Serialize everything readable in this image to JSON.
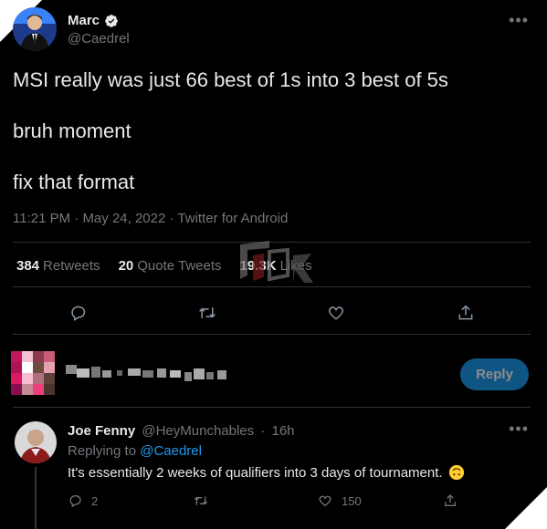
{
  "tweet": {
    "display_name": "Marc",
    "handle": "@Caedrel",
    "lines": [
      "MSI really was just 66 best of 1s into 3 best of 5s",
      "bruh moment",
      "fix that format"
    ],
    "time": "11:21 PM",
    "date": "May 24, 2022",
    "source": "Twitter for Android",
    "retweets_count": "384",
    "retweets_label": "Retweets",
    "quotes_count": "20",
    "quotes_label": "Quote Tweets",
    "likes_count": "19.3K",
    "likes_label": "Likes"
  },
  "composer": {
    "reply_label": "Reply"
  },
  "reply": {
    "display_name": "Joe Fenny",
    "handle": "@HeyMunchables",
    "time": "16h",
    "replying_prefix": "Replying to",
    "replying_to": "@Caedrel",
    "text": "It's essentially 2 weeks of qualifiers into 3 days of tournament.",
    "reply_count": "2",
    "like_count": "150"
  },
  "icons": {
    "verified": "verified-badge-icon",
    "more": "more-horizontal-icon",
    "reply": "reply-bubble-icon",
    "retweet": "retweet-icon",
    "like": "heart-icon",
    "share": "share-icon",
    "emoji": "upside-down-face-icon"
  },
  "colors": {
    "background": "#000000",
    "text": "#e7e9ea",
    "muted": "#71767b",
    "accent": "#1d9bf0",
    "divider": "#2f3336"
  }
}
